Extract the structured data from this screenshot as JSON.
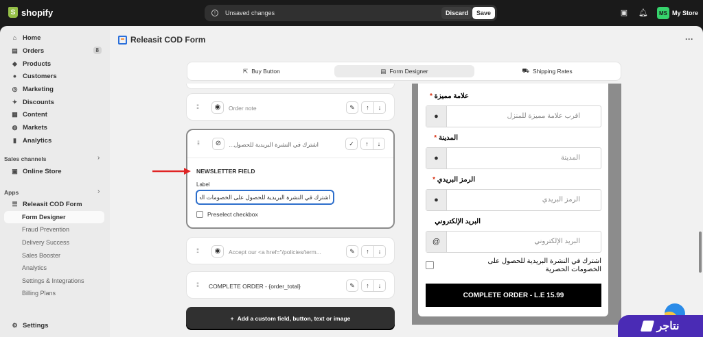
{
  "topbar": {
    "brand": "shopify",
    "logo_letter": "S",
    "unsaved_text": "Unsaved changes",
    "discard_label": "Discard",
    "save_label": "Save",
    "store_initials": "MS",
    "store_name": "My Store"
  },
  "sidebar": {
    "items": [
      {
        "label": "Home",
        "icon": "home-icon"
      },
      {
        "label": "Orders",
        "icon": "orders-icon",
        "badge": "8"
      },
      {
        "label": "Products",
        "icon": "products-icon"
      },
      {
        "label": "Customers",
        "icon": "customers-icon"
      },
      {
        "label": "Marketing",
        "icon": "marketing-icon"
      },
      {
        "label": "Discounts",
        "icon": "discounts-icon"
      },
      {
        "label": "Content",
        "icon": "content-icon"
      },
      {
        "label": "Markets",
        "icon": "markets-icon"
      },
      {
        "label": "Analytics",
        "icon": "analytics-icon"
      }
    ],
    "sales_channels_label": "Sales channels",
    "online_store_label": "Online Store",
    "apps_label": "Apps",
    "app_name": "Releasit COD Form",
    "app_subitems": [
      "Form Designer",
      "Fraud Prevention",
      "Delivery Success",
      "Sales Booster",
      "Analytics",
      "Settings & Integrations",
      "Billing Plans"
    ],
    "settings_label": "Settings"
  },
  "main": {
    "app_title": "Releasit COD Form",
    "tabs": [
      {
        "label": "Buy Button",
        "icon": "cursor-icon"
      },
      {
        "label": "Form Designer",
        "icon": "form-icon"
      },
      {
        "label": "Shipping Rates",
        "icon": "truck-icon"
      }
    ],
    "fields": {
      "order_note": "Order note",
      "newsletter_collapsed": "اشترك في النشرة البريدية للحصول...",
      "newsletter_section_title": "NEWSLETTER FIELD",
      "label_caption": "Label",
      "label_value": "اشترك في النشرة البريدية للحصول على الخصومات الحصرية",
      "preselect_label": "Preselect checkbox",
      "accept_text": "Accept our <a href=\"/policies/term...",
      "complete_order_text": "COMPLETE ORDER - {order_total}"
    },
    "add_button_label": "Add a custom field, button, text or image"
  },
  "preview": {
    "fields": [
      {
        "label": "علامة مميزة",
        "required": true,
        "placeholder": "اقرب علامة مميزة للمنزل",
        "icon": "location-pin-icon"
      },
      {
        "label": "المدينة",
        "required": true,
        "placeholder": "المدينة",
        "icon": "location-pin-icon"
      },
      {
        "label": "الرمز البريدي",
        "required": true,
        "placeholder": "الرمز البريدي",
        "icon": "location-pin-icon"
      },
      {
        "label": "البريد الإلكتروني",
        "required": false,
        "placeholder": "البريد الإلكتروني",
        "icon": "at-icon"
      }
    ],
    "required_mark": "*",
    "newsletter_text": "اشترك في النشرة البريدية للحصول على الخصومات الحصرية",
    "order_button": "COMPLETE ORDER -  L.E 15.99"
  },
  "watermark": {
    "text": "نتاجر"
  },
  "colors": {
    "accent": "#2c6ecb",
    "annotation_arrow": "#e02424",
    "brand_purple": "#4a2bb5",
    "store_avatar": "#36d36c"
  }
}
